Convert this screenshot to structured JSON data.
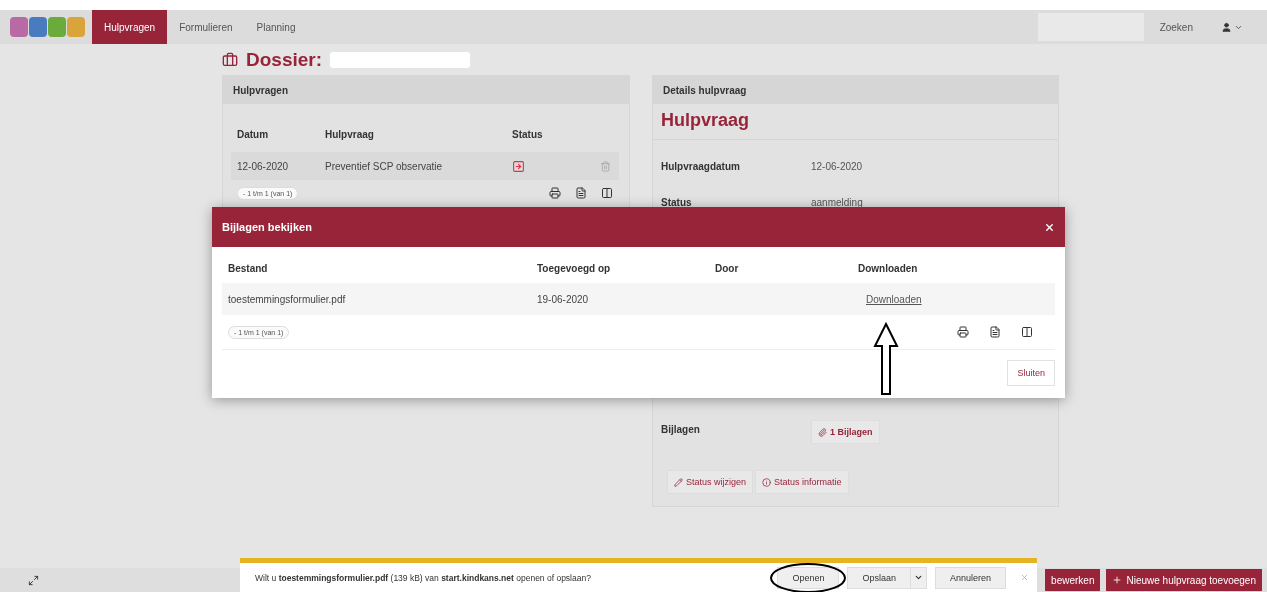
{
  "nav": {
    "tabs": [
      {
        "label": "Hulpvragen",
        "selected": true
      },
      {
        "label": "Formulieren",
        "selected": false
      },
      {
        "label": "Planning",
        "selected": false
      }
    ],
    "search_button": "Zoeken"
  },
  "page": {
    "title": "Dossier:"
  },
  "hulpvragen_panel": {
    "title": "Hulpvragen",
    "columns": [
      "Datum",
      "Hulpvraag",
      "Status"
    ],
    "rows": [
      {
        "datum": "12-06-2020",
        "hulpvraag": "Preventief SCP observatie"
      }
    ],
    "pager": "- 1 t/m 1 (van 1)"
  },
  "details_panel": {
    "title": "Details hulpvraag",
    "heading": "Hulpvraag",
    "fields": [
      {
        "label": "Hulpvraagdatum",
        "value": "12-06-2020"
      },
      {
        "label": "Status",
        "value": "aanmelding"
      }
    ],
    "attachments": {
      "label": "Bijlagen",
      "button": "1 Bijlagen"
    },
    "actions": [
      {
        "kind": "edit",
        "label": "Status wijzigen"
      },
      {
        "kind": "info",
        "label": "Status informatie"
      }
    ]
  },
  "modal": {
    "title": "Bijlagen bekijken",
    "columns": [
      "Bestand",
      "Toegevoegd op",
      "Door",
      "Downloaden"
    ],
    "rows": [
      {
        "bestand": "toestemmingsformulier.pdf",
        "toegevoegd_op": "19-06-2020",
        "downloaden": "Downloaden"
      }
    ],
    "pager": "- 1 t/m 1 (van 1)",
    "close_button": "Sluiten"
  },
  "footer": {
    "buttons": [
      {
        "kind": "plain",
        "label": "bewerken"
      },
      {
        "kind": "add",
        "label": "Nieuwe hulpvraag toevoegen"
      }
    ]
  },
  "download_bar": {
    "message": "Wilt u **toestemmingsformulier.pdf** (139 kB) van **start.kindkans.net** openen of opslaan?",
    "buttons": [
      "Openen",
      "Opslaan",
      "Annuleren"
    ]
  }
}
